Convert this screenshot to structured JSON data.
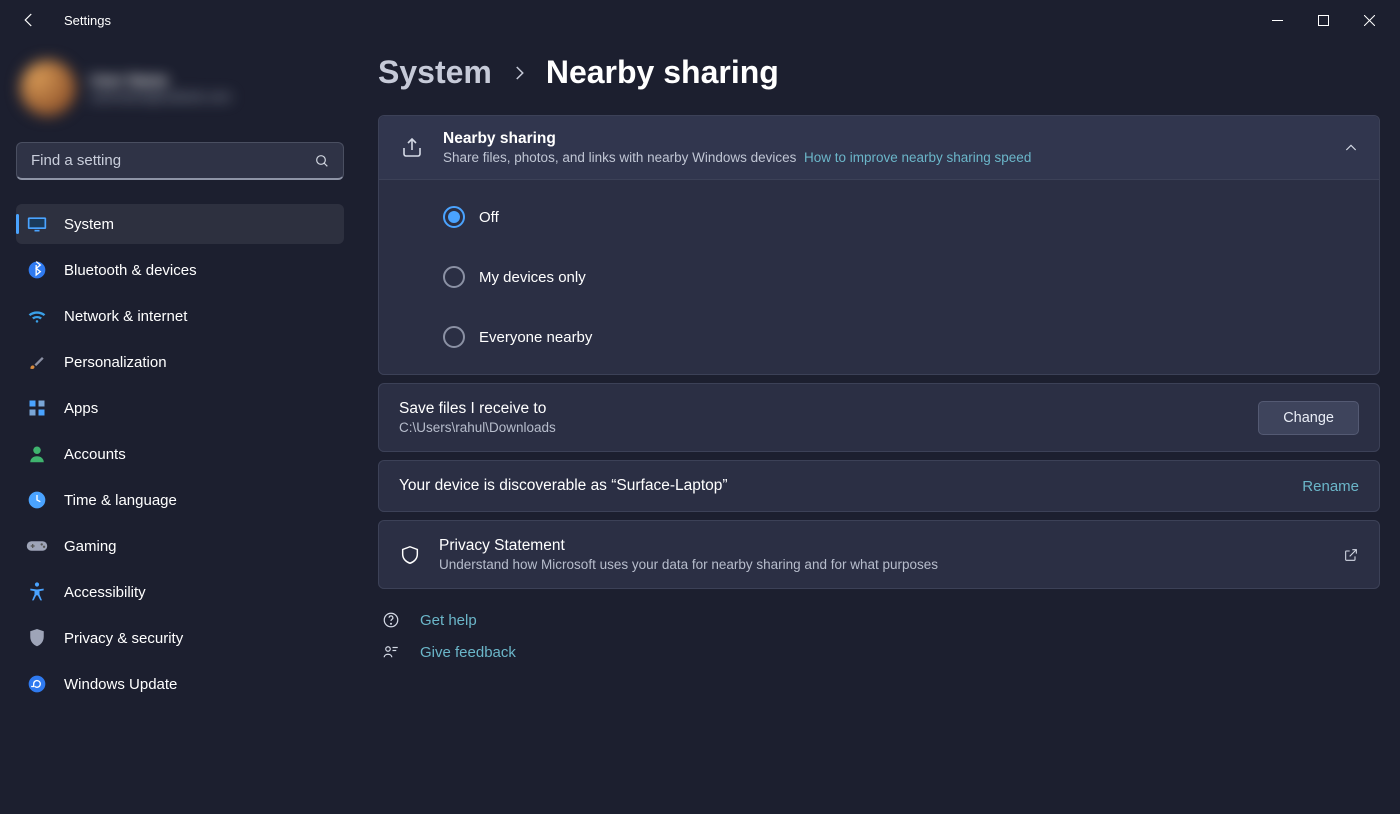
{
  "window": {
    "title": "Settings"
  },
  "profile": {
    "name": "User Name",
    "email": "username@outlook.com"
  },
  "search": {
    "placeholder": "Find a setting"
  },
  "nav": [
    {
      "label": "System",
      "icon": "display-icon",
      "active": true
    },
    {
      "label": "Bluetooth & devices",
      "icon": "bluetooth-icon",
      "active": false
    },
    {
      "label": "Network & internet",
      "icon": "wifi-icon",
      "active": false
    },
    {
      "label": "Personalization",
      "icon": "paintbrush-icon",
      "active": false
    },
    {
      "label": "Apps",
      "icon": "apps-icon",
      "active": false
    },
    {
      "label": "Accounts",
      "icon": "person-icon",
      "active": false
    },
    {
      "label": "Time & language",
      "icon": "clock-icon",
      "active": false
    },
    {
      "label": "Gaming",
      "icon": "gamepad-icon",
      "active": false
    },
    {
      "label": "Accessibility",
      "icon": "accessibility-icon",
      "active": false
    },
    {
      "label": "Privacy & security",
      "icon": "shield-icon",
      "active": false
    },
    {
      "label": "Windows Update",
      "icon": "update-icon",
      "active": false
    }
  ],
  "breadcrumb": {
    "root": "System",
    "leaf": "Nearby sharing"
  },
  "nearby": {
    "title": "Nearby sharing",
    "subtitle": "Share files, photos, and links with nearby Windows devices",
    "link": "How to improve nearby sharing speed",
    "options": [
      {
        "label": "Off",
        "selected": true
      },
      {
        "label": "My devices only",
        "selected": false
      },
      {
        "label": "Everyone nearby",
        "selected": false
      }
    ]
  },
  "save": {
    "title": "Save files I receive to",
    "path": "C:\\Users\\rahul\\Downloads",
    "button": "Change"
  },
  "discoverable": {
    "text": "Your device is discoverable as “Surface-Laptop”",
    "action": "Rename"
  },
  "privacy": {
    "title": "Privacy Statement",
    "subtitle": "Understand how Microsoft uses your data for nearby sharing and for what purposes"
  },
  "support": {
    "help": "Get help",
    "feedback": "Give feedback"
  }
}
